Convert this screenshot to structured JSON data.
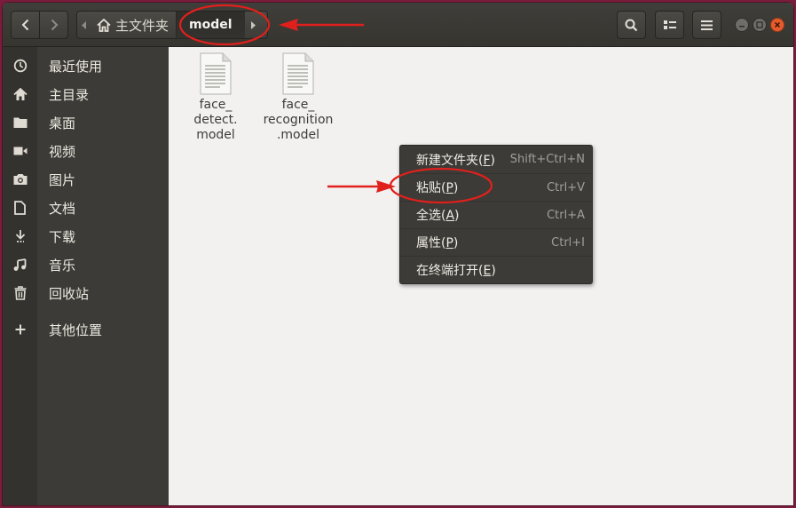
{
  "header": {
    "back_icon": "chevron-left-icon",
    "forward_icon": "chevron-right-icon",
    "home_crumb": "主文件夹",
    "current_crumb": "model",
    "search_icon": "search-icon",
    "view_icon": "view-toggle-icon",
    "menu_icon": "hamburger-menu-icon"
  },
  "sidebar": {
    "items": [
      {
        "label": "最近使用",
        "icon": "clock-icon"
      },
      {
        "label": "主目录",
        "icon": "home-icon"
      },
      {
        "label": "桌面",
        "icon": "folder-icon"
      },
      {
        "label": "视频",
        "icon": "video-icon"
      },
      {
        "label": "图片",
        "icon": "camera-icon"
      },
      {
        "label": "文档",
        "icon": "document-icon"
      },
      {
        "label": "下载",
        "icon": "download-icon"
      },
      {
        "label": "音乐",
        "icon": "music-icon"
      },
      {
        "label": "回收站",
        "icon": "trash-icon"
      },
      {
        "label": "其他位置",
        "icon": "plus-icon"
      }
    ]
  },
  "files": [
    {
      "name": "face_\ndetect.\nmodel",
      "icon": "text-file-icon"
    },
    {
      "name": "face_\nrecognition\n.model",
      "icon": "text-file-icon"
    }
  ],
  "context_menu": {
    "items": [
      {
        "label_pre": "新建文件夹(",
        "mnemonic": "F",
        "label_post": ")",
        "shortcut": "Shift+Ctrl+N"
      },
      {
        "label_pre": "粘贴(",
        "mnemonic": "P",
        "label_post": ")",
        "shortcut": "Ctrl+V"
      },
      {
        "label_pre": "全选(",
        "mnemonic": "A",
        "label_post": ")",
        "shortcut": "Ctrl+A"
      },
      {
        "label_pre": "属性(",
        "mnemonic": "P",
        "label_post": ")",
        "shortcut": "Ctrl+I"
      },
      {
        "label_pre": "在终端打开(",
        "mnemonic": "E",
        "label_post": ")",
        "shortcut": ""
      }
    ]
  },
  "colors": {
    "desktop_bg": "#7a1c3c",
    "headerbar": "#3c3b37",
    "sidebar": "#3c3b37",
    "content": "#f2f1f0",
    "close_button": "#e55b2b",
    "annotation_red": "#e0201c"
  }
}
